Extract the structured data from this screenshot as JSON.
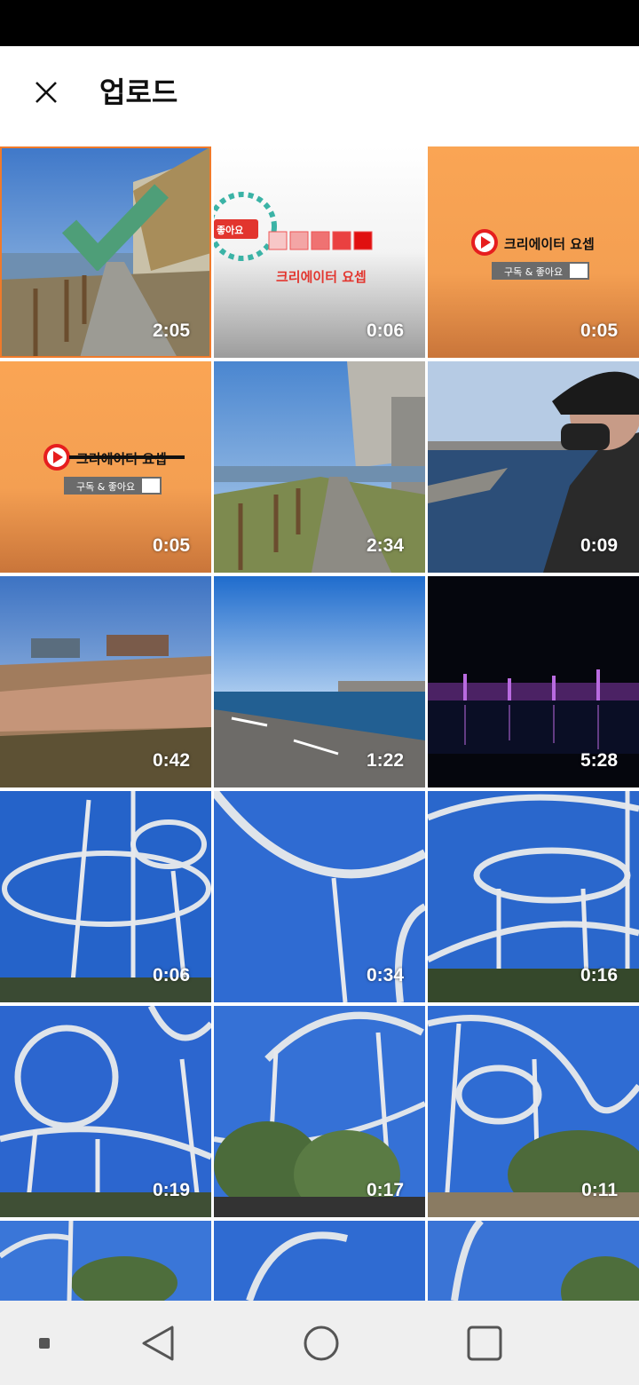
{
  "header": {
    "title": "업로드"
  },
  "colors": {
    "accent": "#f07a2a",
    "check": "#4e9e78",
    "brand_orange": "#f9a352",
    "brand_red": "#e61e1e"
  },
  "thumbs": [
    {
      "duration": "2:05",
      "selected": true
    },
    {
      "duration": "0:06",
      "logo_text": "좋아요",
      "channel_text": "크리에이터 요셉"
    },
    {
      "duration": "0:05",
      "channel_text": "크리에이터 요셉",
      "sub_text": "구독 & 좋아요"
    },
    {
      "duration": "0:05",
      "channel_text": "크리에이터 요셉",
      "sub_text": "구독 & 좋아요"
    },
    {
      "duration": "2:34"
    },
    {
      "duration": "0:09"
    },
    {
      "duration": "0:42"
    },
    {
      "duration": "1:22"
    },
    {
      "duration": "5:28"
    },
    {
      "duration": "0:06"
    },
    {
      "duration": "0:34"
    },
    {
      "duration": "0:16"
    },
    {
      "duration": "0:19"
    },
    {
      "duration": "0:17"
    },
    {
      "duration": "0:11"
    },
    {
      "duration": ""
    },
    {
      "duration": ""
    },
    {
      "duration": ""
    }
  ],
  "nav": {
    "icons": [
      "recents-dot-icon",
      "back-icon",
      "home-icon",
      "overview-icon"
    ]
  }
}
